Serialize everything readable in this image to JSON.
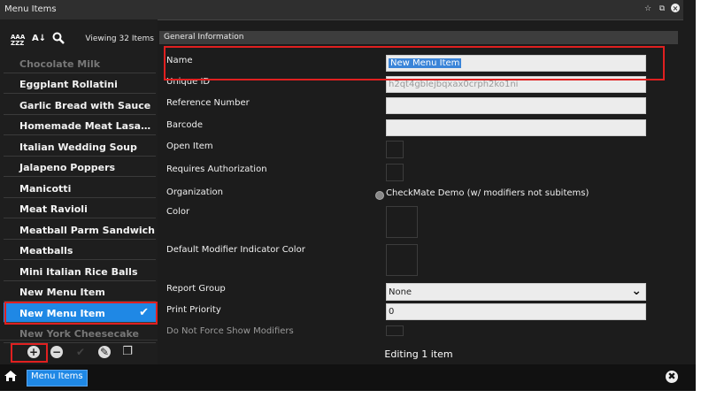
{
  "window": {
    "title": "Menu Items"
  },
  "window_controls": {
    "star": "☆",
    "restore": "⧉",
    "close": "×"
  },
  "toolbar": {
    "viewing_label": "Viewing 32 Items",
    "sort_az": "AAA ZZZ",
    "sort_num": "A↓Z"
  },
  "list": {
    "items": [
      {
        "label": "Chocolate Milk",
        "faded": true
      },
      {
        "label": "Eggplant Rollatini"
      },
      {
        "label": "Garlic Bread with Sauce"
      },
      {
        "label": "Homemade Meat Lasag..."
      },
      {
        "label": "Italian Wedding Soup"
      },
      {
        "label": "Jalapeno Poppers"
      },
      {
        "label": "Manicotti"
      },
      {
        "label": "Meat Ravioli"
      },
      {
        "label": "Meatball Parm Sandwich"
      },
      {
        "label": "Meatballs"
      },
      {
        "label": "Mini Italian Rice Balls"
      },
      {
        "label": "New Menu Item"
      },
      {
        "label": "New Menu Item",
        "selected": true
      },
      {
        "label": "New York Cheesecake",
        "faded": true
      }
    ]
  },
  "footer_icons": [
    "add-icon",
    "remove-icon",
    "check-icon",
    "edit-icon",
    "copy-icon"
  ],
  "section": {
    "title": "General Information"
  },
  "form": {
    "name_label": "Name",
    "name_value": "New Menu Item",
    "uid_label": "Unique ID",
    "uid_value": "h2qt4gblejbqxax0crph2ko1ni",
    "ref_label": "Reference Number",
    "ref_value": "",
    "barcode_label": "Barcode",
    "barcode_value": "",
    "open_item_label": "Open Item",
    "requires_auth_label": "Requires Authorization",
    "org_label": "Organization",
    "org_value": "CheckMate Demo (w/ modifiers not subitems)",
    "color_label": "Color",
    "default_mod_color_label": "Default Modifier Indicator Color",
    "report_group_label": "Report Group",
    "report_group_value": "None",
    "print_priority_label": "Print Priority",
    "print_priority_value": "0",
    "no_force_label": "Do Not Force Show Modifiers"
  },
  "status": {
    "editing": "Editing 1 item"
  },
  "bottom": {
    "tab_label": "Menu Items"
  },
  "colors": {
    "accent": "#1f88e5",
    "highlight": "#e02020",
    "background": "#1c1c1c"
  }
}
